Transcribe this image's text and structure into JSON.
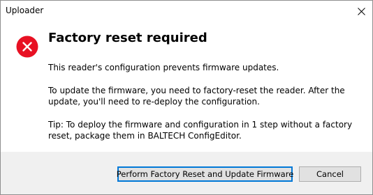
{
  "window": {
    "title": "Uploader"
  },
  "dialog": {
    "heading": "Factory reset required",
    "paragraphs": [
      "This reader's configuration prevents firmware updates.",
      "To update the firmware, you need to factory-reset the reader. After the update, you'll need to re-deploy the configuration.",
      "Tip: To deploy the firmware and configuration in 1 step without a factory reset, package them in BALTECH ConfigEditor."
    ]
  },
  "buttons": {
    "primary_label": "Perform Factory Reset and Update Firmware",
    "cancel_label": "Cancel"
  },
  "icons": {
    "status": "error-icon",
    "close": "close-icon"
  },
  "colors": {
    "error_red": "#e81123",
    "footer_bg": "#f0f0f0",
    "focus_border": "#0078d7"
  }
}
